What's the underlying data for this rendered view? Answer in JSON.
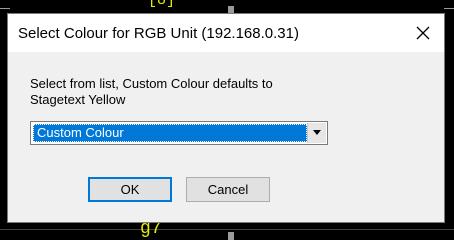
{
  "background": {
    "top_label": "[8]",
    "bottom_label": "g7"
  },
  "dialog": {
    "title": "Select Colour for RGB Unit (192.168.0.31)",
    "prompt_line1": "Select from list, Custom Colour defaults to",
    "prompt_line2": "Stagetext Yellow",
    "selected_colour": "Custom Colour",
    "ok_label": "OK",
    "cancel_label": "Cancel"
  },
  "colors": {
    "accent": "#0078d7",
    "background_text": "#e8e800"
  }
}
